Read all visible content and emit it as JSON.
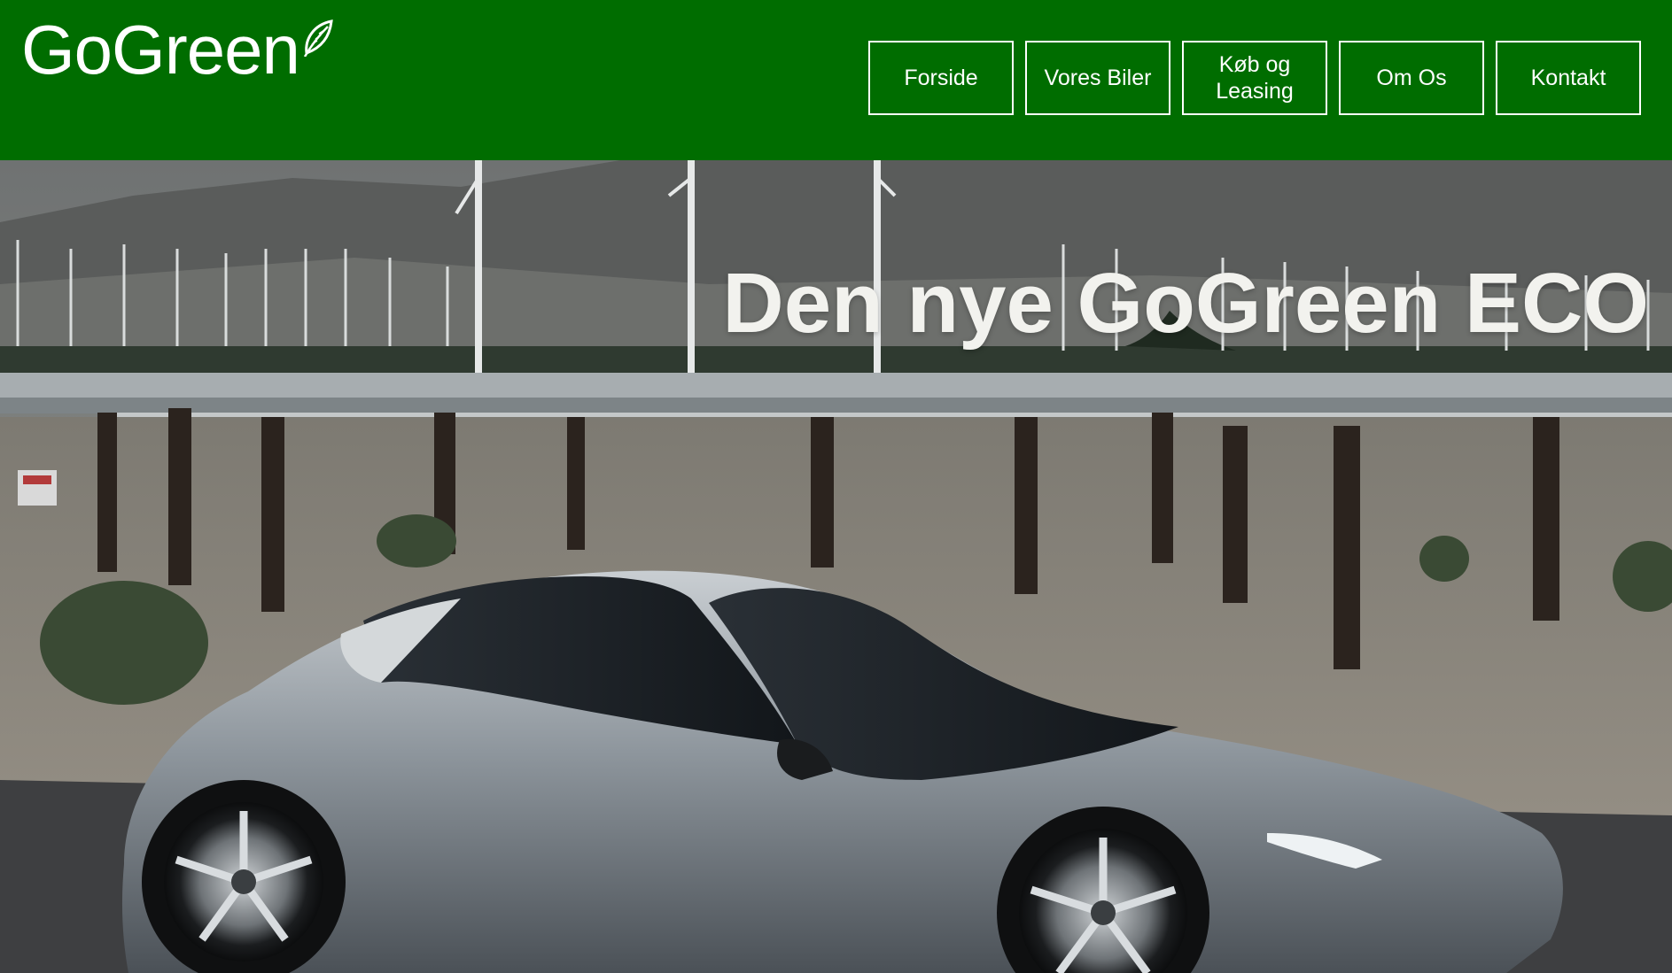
{
  "brand": {
    "name": "GoGreen",
    "logo_icon": "leaf-icon"
  },
  "nav": {
    "items": [
      {
        "label": "Forside"
      },
      {
        "label": "Vores Biler"
      },
      {
        "label": "Køb og Leasing"
      },
      {
        "label": "Om Os"
      },
      {
        "label": "Kontakt"
      }
    ]
  },
  "hero": {
    "title": "Den nye GoGreen ECO",
    "image_subject": "hero-car-image"
  },
  "colors": {
    "header_bg": "#006d00",
    "nav_border": "#ffffff",
    "title_text": "#f2f2ee"
  }
}
